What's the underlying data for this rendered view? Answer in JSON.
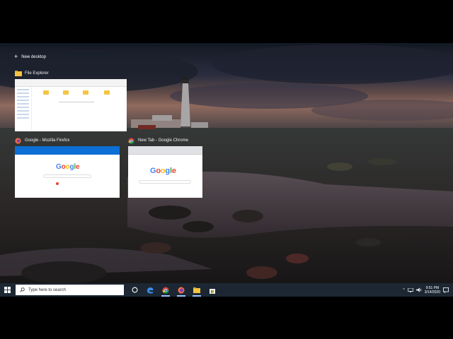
{
  "task_view": {
    "new_desktop_label": "New desktop",
    "windows": [
      {
        "title": "File Explorer",
        "icon": "folder-icon"
      },
      {
        "title": "Google - Mozilla Firefox",
        "icon": "firefox-icon",
        "page_logo": "Google"
      },
      {
        "title": "New Tab - Google Chrome",
        "icon": "chrome-icon",
        "page_logo": "Google"
      }
    ]
  },
  "taskbar": {
    "search_placeholder": "Type here to search",
    "pinned": [
      "task-view-icon",
      "edge-icon",
      "chrome-icon",
      "firefox-icon",
      "file-explorer-icon",
      "store-icon"
    ],
    "clock": {
      "time": "9:51 PM",
      "date": "3/14/2020"
    }
  },
  "colors": {
    "taskbar": "#1c2733",
    "google_blue": "#4285F4",
    "google_red": "#EA4335",
    "google_yellow": "#FBBC05",
    "google_green": "#34A853"
  }
}
